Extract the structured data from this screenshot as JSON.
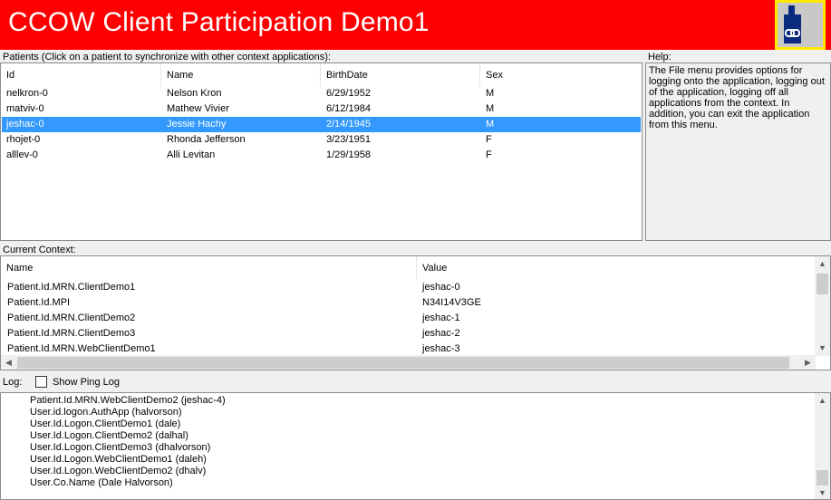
{
  "app": {
    "title": "CCOW Client Participation Demo1",
    "banner_color": "#ff0000",
    "logo_icon": "ccow-link-person-icon"
  },
  "patients": {
    "label": "Patients (Click on a patient to synchronize with other context applications):",
    "columns": [
      "Id",
      "Name",
      "BirthDate",
      "Sex"
    ],
    "rows": [
      {
        "id": "nelkron-0",
        "name": "Nelson Kron",
        "birthdate": "6/29/1952",
        "sex": "M",
        "selected": false
      },
      {
        "id": "matviv-0",
        "name": "Mathew Vivier",
        "birthdate": "6/12/1984",
        "sex": "M",
        "selected": false
      },
      {
        "id": "jeshac-0",
        "name": "Jessie Hachy",
        "birthdate": "2/14/1945",
        "sex": "M",
        "selected": true
      },
      {
        "id": "rhojet-0",
        "name": "Rhonda Jefferson",
        "birthdate": "3/23/1951",
        "sex": "F",
        "selected": false
      },
      {
        "id": "alllev-0",
        "name": "Alli Levitan",
        "birthdate": "1/29/1958",
        "sex": "F",
        "selected": false
      }
    ],
    "selection_color": "#3399ff"
  },
  "help": {
    "label": "Help:",
    "text": "The File menu provides options for logging onto the application, logging out of the application, logging off all applications from the context. In addition, you can exit the application from this menu."
  },
  "context": {
    "label": "Current Context:",
    "columns": [
      "Name",
      "Value"
    ],
    "rows": [
      {
        "name": "Patient.Id.MRN.ClientDemo1",
        "value": "jeshac-0"
      },
      {
        "name": "Patient.Id.MPI",
        "value": "N34I14V3GE"
      },
      {
        "name": "Patient.Id.MRN.ClientDemo2",
        "value": "jeshac-1"
      },
      {
        "name": "Patient.Id.MRN.ClientDemo3",
        "value": "jeshac-2"
      },
      {
        "name": "Patient.Id.MRN.WebClientDemo1",
        "value": "jeshac-3"
      }
    ]
  },
  "log": {
    "label": "Log:",
    "show_ping_label": "Show Ping Log",
    "show_ping_checked": false,
    "lines": [
      "Patient.Id.MRN.WebClientDemo2 (jeshac-4)",
      "User.id.logon.AuthApp (halvorson)",
      "User.Id.Logon.ClientDemo1 (dale)",
      "User.Id.Logon.ClientDemo2 (dalhal)",
      "User.Id.Logon.ClientDemo3 (dhalvorson)",
      "User.Id.Logon.WebClientDemo1 (daleh)",
      "User.Id.Logon.WebClientDemo2 (dhalv)",
      "User.Co.Name (Dale Halvorson)"
    ]
  }
}
